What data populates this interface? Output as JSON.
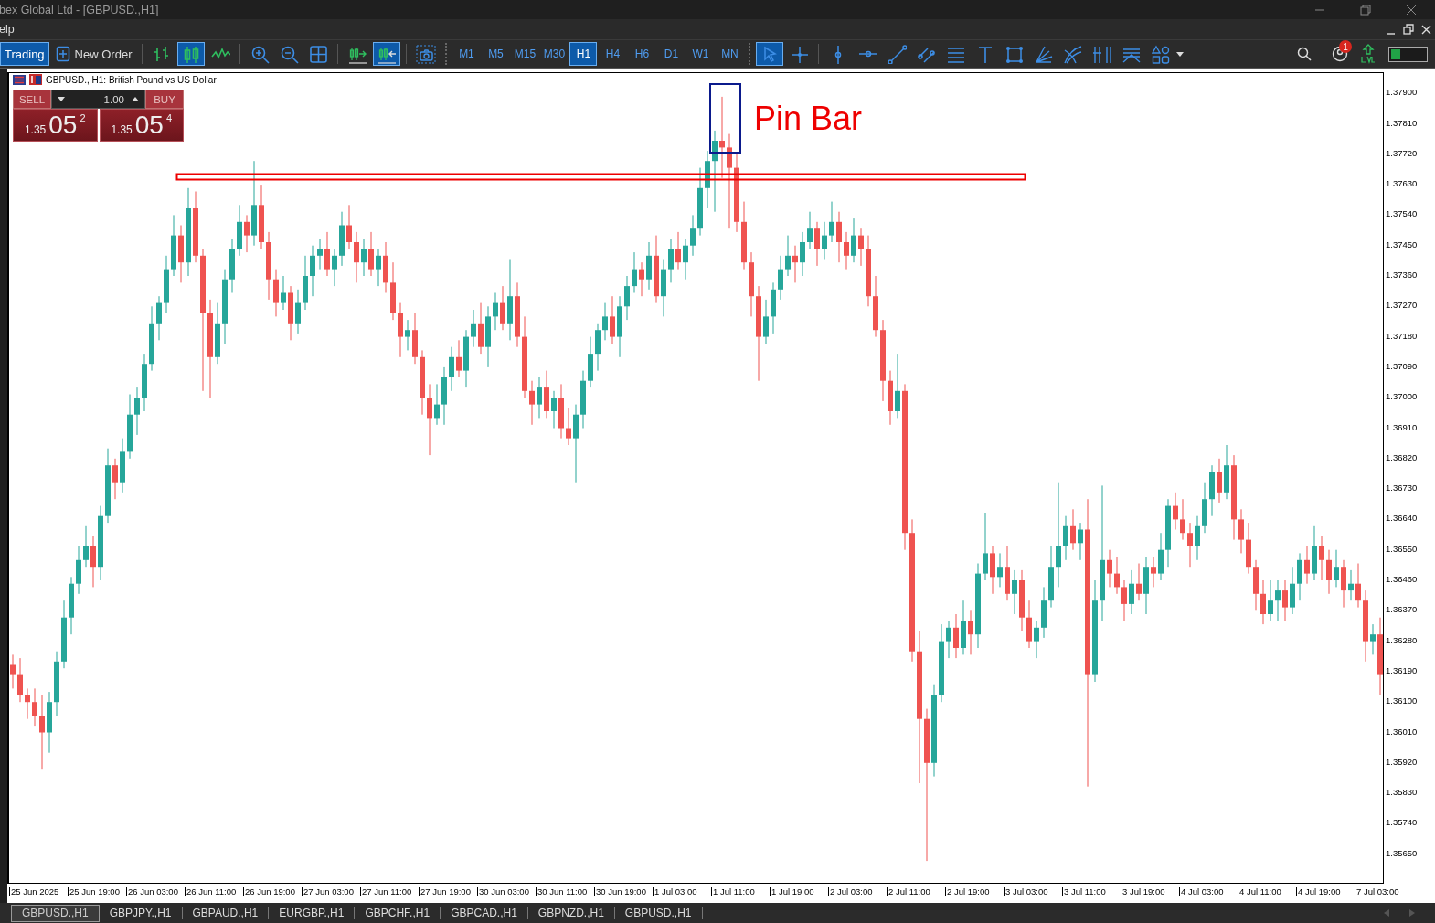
{
  "window": {
    "title": "bex Global Ltd - [GBPUSD.,H1]"
  },
  "menu": [
    "elp"
  ],
  "toolbar": {
    "trading": {
      "label": "Trading",
      "selected": true
    },
    "new_order": "New Order",
    "chart_types": [
      {
        "kind": "bars",
        "selected": false
      },
      {
        "kind": "candles",
        "selected": true
      },
      {
        "kind": "line",
        "selected": false
      }
    ],
    "chart_controls": [
      {
        "kind": "zoom-in"
      },
      {
        "kind": "zoom-out"
      },
      {
        "kind": "grid"
      }
    ],
    "scroll_controls": [
      {
        "kind": "shift",
        "selected": false
      },
      {
        "kind": "autoscroll",
        "selected": true
      }
    ],
    "timeframes": [
      {
        "label": "M1",
        "selected": false
      },
      {
        "label": "M5",
        "selected": false
      },
      {
        "label": "M15",
        "selected": false
      },
      {
        "label": "M30",
        "selected": false
      },
      {
        "label": "H1",
        "selected": true
      },
      {
        "label": "H4",
        "selected": false
      },
      {
        "label": "H6",
        "selected": false
      },
      {
        "label": "D1",
        "selected": false
      },
      {
        "label": "W1",
        "selected": false
      },
      {
        "label": "MN",
        "selected": false
      }
    ],
    "tools": [
      {
        "kind": "cursor",
        "selected": true
      },
      {
        "kind": "crosshair",
        "selected": false
      },
      {
        "kind": "vline",
        "selected": false
      },
      {
        "kind": "hline",
        "selected": false
      },
      {
        "kind": "trendline",
        "selected": false
      },
      {
        "kind": "channel",
        "selected": false
      },
      {
        "kind": "fibo",
        "selected": false
      },
      {
        "kind": "text",
        "selected": false
      },
      {
        "kind": "rectangle",
        "selected": false
      },
      {
        "kind": "fan",
        "selected": false
      },
      {
        "kind": "arcs",
        "selected": false
      },
      {
        "kind": "timezones",
        "selected": false
      },
      {
        "kind": "pitchfork",
        "selected": false
      },
      {
        "kind": "shapes",
        "selected": false
      }
    ],
    "notification_badge": "1"
  },
  "chart": {
    "title": "GBPUSD., H1:  British Pound vs US Dollar",
    "trade_panel": {
      "sell_label": "SELL",
      "buy_label": "BUY",
      "volume": "1.00",
      "sell_price": {
        "prefix": "1.35",
        "big": "05",
        "point": "2"
      },
      "buy_price": {
        "prefix": "1.35",
        "big": "05",
        "point": "4"
      }
    },
    "annotation": "Pin Bar",
    "time_axis": [
      "25 Jun 2025",
      "25 Jun 19:00",
      "26 Jun 03:00",
      "26 Jun 11:00",
      "26 Jun 19:00",
      "27 Jun 03:00",
      "27 Jun 11:00",
      "27 Jun 19:00",
      "30 Jun 03:00",
      "30 Jun 11:00",
      "30 Jun 19:00",
      "1 Jul 03:00",
      "1 Jul 11:00",
      "1 Jul 19:00",
      "2 Jul 03:00",
      "2 Jul 11:00",
      "2 Jul 19:00",
      "3 Jul 03:00",
      "3 Jul 11:00",
      "3 Jul 19:00",
      "4 Jul 03:00",
      "4 Jul 11:00",
      "4 Jul 19:00",
      "7 Jul 03:00"
    ],
    "chart_data": {
      "type": "candlestick",
      "ylim": [
        1.3556,
        1.3796
      ],
      "yticks": [
        {
          "value": 1.379,
          "label": "1.37900"
        },
        {
          "value": 1.3781,
          "label": "1.37810"
        },
        {
          "value": 1.3772,
          "label": "1.37720"
        },
        {
          "value": 1.3763,
          "label": "1.37630"
        },
        {
          "value": 1.3754,
          "label": "1.37540"
        },
        {
          "value": 1.3745,
          "label": "1.37450"
        },
        {
          "value": 1.3736,
          "label": "1.37360"
        },
        {
          "value": 1.3727,
          "label": "1.37270"
        },
        {
          "value": 1.3718,
          "label": "1.37180"
        },
        {
          "value": 1.3709,
          "label": "1.37090"
        },
        {
          "value": 1.37,
          "label": "1.37000"
        },
        {
          "value": 1.3691,
          "label": "1.36910"
        },
        {
          "value": 1.3682,
          "label": "1.36820"
        },
        {
          "value": 1.3673,
          "label": "1.36730"
        },
        {
          "value": 1.3664,
          "label": "1.36640"
        },
        {
          "value": 1.3655,
          "label": "1.36550"
        },
        {
          "value": 1.3646,
          "label": "1.36460"
        },
        {
          "value": 1.3637,
          "label": "1.36370"
        },
        {
          "value": 1.3628,
          "label": "1.36280"
        },
        {
          "value": 1.3619,
          "label": "1.36190"
        },
        {
          "value": 1.361,
          "label": "1.36100"
        },
        {
          "value": 1.3601,
          "label": "1.36010"
        },
        {
          "value": 1.3592,
          "label": "1.35920"
        },
        {
          "value": 1.3583,
          "label": "1.35830"
        },
        {
          "value": 1.3574,
          "label": "1.35740"
        },
        {
          "value": 1.3565,
          "label": "1.35650"
        }
      ],
      "ohlc": [
        [
          1.3621,
          1.3624,
          1.3614,
          1.3618
        ],
        [
          1.3618,
          1.3623,
          1.361,
          1.3612
        ],
        [
          1.3612,
          1.3614,
          1.3605,
          1.361
        ],
        [
          1.361,
          1.3614,
          1.3603,
          1.3606
        ],
        [
          1.3606,
          1.3612,
          1.359,
          1.3601
        ],
        [
          1.3601,
          1.3613,
          1.3595,
          1.361
        ],
        [
          1.361,
          1.3625,
          1.3606,
          1.3622
        ],
        [
          1.3622,
          1.364,
          1.362,
          1.3635
        ],
        [
          1.3635,
          1.3647,
          1.363,
          1.3645
        ],
        [
          1.3645,
          1.3656,
          1.3642,
          1.3652
        ],
        [
          1.3652,
          1.3662,
          1.365,
          1.3656
        ],
        [
          1.3656,
          1.3659,
          1.3644,
          1.365
        ],
        [
          1.365,
          1.3668,
          1.3646,
          1.3665
        ],
        [
          1.3665,
          1.3685,
          1.3663,
          1.368
        ],
        [
          1.368,
          1.3682,
          1.367,
          1.3675
        ],
        [
          1.3675,
          1.3688,
          1.3672,
          1.3684
        ],
        [
          1.3684,
          1.3701,
          1.3682,
          1.3695
        ],
        [
          1.3695,
          1.3703,
          1.3689,
          1.37
        ],
        [
          1.37,
          1.3713,
          1.3696,
          1.371
        ],
        [
          1.371,
          1.3727,
          1.3708,
          1.3722
        ],
        [
          1.3722,
          1.373,
          1.3717,
          1.3728
        ],
        [
          1.3728,
          1.3742,
          1.3725,
          1.3738
        ],
        [
          1.3738,
          1.3754,
          1.3736,
          1.3748
        ],
        [
          1.3748,
          1.3751,
          1.3734,
          1.374
        ],
        [
          1.374,
          1.3762,
          1.3736,
          1.3756
        ],
        [
          1.3756,
          1.3761,
          1.374,
          1.3742
        ],
        [
          1.3742,
          1.3744,
          1.3702,
          1.3725
        ],
        [
          1.3725,
          1.3729,
          1.37,
          1.3712
        ],
        [
          1.3712,
          1.3728,
          1.371,
          1.3722
        ],
        [
          1.3722,
          1.3738,
          1.3716,
          1.3735
        ],
        [
          1.3735,
          1.3747,
          1.3731,
          1.3744
        ],
        [
          1.3744,
          1.3757,
          1.3742,
          1.3752
        ],
        [
          1.3752,
          1.3754,
          1.3743,
          1.3748
        ],
        [
          1.3748,
          1.377,
          1.3745,
          1.3757
        ],
        [
          1.3757,
          1.3763,
          1.3744,
          1.3746
        ],
        [
          1.3746,
          1.3749,
          1.3729,
          1.3735
        ],
        [
          1.3735,
          1.3738,
          1.3724,
          1.3728
        ],
        [
          1.3728,
          1.3736,
          1.3726,
          1.3731
        ],
        [
          1.3731,
          1.3733,
          1.3717,
          1.3722
        ],
        [
          1.3722,
          1.3732,
          1.3719,
          1.3728
        ],
        [
          1.3728,
          1.3742,
          1.3726,
          1.3736
        ],
        [
          1.3736,
          1.3745,
          1.373,
          1.3742
        ],
        [
          1.3742,
          1.3747,
          1.3738,
          1.3744
        ],
        [
          1.3744,
          1.3749,
          1.3736,
          1.3738
        ],
        [
          1.3738,
          1.3744,
          1.3733,
          1.3742
        ],
        [
          1.3742,
          1.3755,
          1.3739,
          1.3751
        ],
        [
          1.3751,
          1.3757,
          1.3744,
          1.3746
        ],
        [
          1.3746,
          1.3749,
          1.3734,
          1.374
        ],
        [
          1.374,
          1.3747,
          1.3736,
          1.3744
        ],
        [
          1.3744,
          1.3749,
          1.3736,
          1.3738
        ],
        [
          1.3738,
          1.3744,
          1.3733,
          1.3742
        ],
        [
          1.3742,
          1.3746,
          1.3731,
          1.3734
        ],
        [
          1.3734,
          1.374,
          1.3723,
          1.3725
        ],
        [
          1.3725,
          1.3728,
          1.3712,
          1.3718
        ],
        [
          1.3718,
          1.3723,
          1.3714,
          1.372
        ],
        [
          1.372,
          1.3725,
          1.371,
          1.3712
        ],
        [
          1.3712,
          1.3714,
          1.3695,
          1.37
        ],
        [
          1.37,
          1.3704,
          1.3683,
          1.3694
        ],
        [
          1.3694,
          1.3704,
          1.3692,
          1.3698
        ],
        [
          1.3698,
          1.3709,
          1.3692,
          1.3706
        ],
        [
          1.3706,
          1.3715,
          1.3702,
          1.3712
        ],
        [
          1.3712,
          1.3717,
          1.3706,
          1.3708
        ],
        [
          1.3708,
          1.372,
          1.3703,
          1.3718
        ],
        [
          1.3718,
          1.3726,
          1.3715,
          1.3722
        ],
        [
          1.3722,
          1.3728,
          1.3713,
          1.3715
        ],
        [
          1.3715,
          1.3727,
          1.3709,
          1.3724
        ],
        [
          1.3724,
          1.3731,
          1.372,
          1.3728
        ],
        [
          1.3728,
          1.3733,
          1.372,
          1.3722
        ],
        [
          1.3722,
          1.3741,
          1.3717,
          1.373
        ],
        [
          1.373,
          1.3734,
          1.3715,
          1.3718
        ],
        [
          1.3718,
          1.3724,
          1.37,
          1.3702
        ],
        [
          1.3702,
          1.3705,
          1.3692,
          1.3698
        ],
        [
          1.3698,
          1.3706,
          1.3694,
          1.3703
        ],
        [
          1.3703,
          1.3708,
          1.3694,
          1.3696
        ],
        [
          1.3696,
          1.3702,
          1.3691,
          1.37
        ],
        [
          1.37,
          1.3704,
          1.3688,
          1.3691
        ],
        [
          1.3691,
          1.3697,
          1.3686,
          1.3688
        ],
        [
          1.3688,
          1.3698,
          1.3675,
          1.3695
        ],
        [
          1.3695,
          1.3708,
          1.3691,
          1.3705
        ],
        [
          1.3705,
          1.3718,
          1.3703,
          1.3713
        ],
        [
          1.3713,
          1.3722,
          1.3708,
          1.372
        ],
        [
          1.372,
          1.3728,
          1.3717,
          1.3724
        ],
        [
          1.3724,
          1.373,
          1.3716,
          1.3718
        ],
        [
          1.3718,
          1.373,
          1.3712,
          1.3727
        ],
        [
          1.3727,
          1.3736,
          1.3723,
          1.3733
        ],
        [
          1.3733,
          1.3743,
          1.3731,
          1.3738
        ],
        [
          1.3738,
          1.374,
          1.373,
          1.3735
        ],
        [
          1.3735,
          1.3746,
          1.3732,
          1.3742
        ],
        [
          1.3742,
          1.3748,
          1.3728,
          1.373
        ],
        [
          1.373,
          1.3741,
          1.3724,
          1.3738
        ],
        [
          1.3738,
          1.3747,
          1.3734,
          1.3744
        ],
        [
          1.3744,
          1.3749,
          1.3738,
          1.374
        ],
        [
          1.374,
          1.3747,
          1.3735,
          1.3745
        ],
        [
          1.3745,
          1.3754,
          1.3742,
          1.375
        ],
        [
          1.375,
          1.3768,
          1.3748,
          1.3762
        ],
        [
          1.3762,
          1.3773,
          1.3756,
          1.377
        ],
        [
          1.377,
          1.3779,
          1.3755,
          1.3776
        ],
        [
          1.3776,
          1.3789,
          1.3765,
          1.3774
        ],
        [
          1.3774,
          1.3778,
          1.375,
          1.3768
        ],
        [
          1.3768,
          1.3772,
          1.3749,
          1.3752
        ],
        [
          1.3752,
          1.3758,
          1.3738,
          1.374
        ],
        [
          1.374,
          1.3743,
          1.3724,
          1.373
        ],
        [
          1.373,
          1.3733,
          1.3705,
          1.3718
        ],
        [
          1.3718,
          1.3729,
          1.3716,
          1.3724
        ],
        [
          1.3724,
          1.3734,
          1.3719,
          1.3732
        ],
        [
          1.3732,
          1.3742,
          1.3729,
          1.3738
        ],
        [
          1.3738,
          1.3748,
          1.3736,
          1.3742
        ],
        [
          1.3742,
          1.3745,
          1.3734,
          1.374
        ],
        [
          1.374,
          1.3749,
          1.3736,
          1.3746
        ],
        [
          1.3746,
          1.3755,
          1.3744,
          1.375
        ],
        [
          1.375,
          1.3752,
          1.3739,
          1.3744
        ],
        [
          1.3744,
          1.3752,
          1.3741,
          1.3748
        ],
        [
          1.3748,
          1.3758,
          1.3746,
          1.3752
        ],
        [
          1.3752,
          1.3755,
          1.374,
          1.3746
        ],
        [
          1.3746,
          1.3749,
          1.3738,
          1.3742
        ],
        [
          1.3742,
          1.3753,
          1.374,
          1.3748
        ],
        [
          1.3748,
          1.375,
          1.3739,
          1.3744
        ],
        [
          1.3744,
          1.3748,
          1.3727,
          1.373
        ],
        [
          1.373,
          1.3736,
          1.3718,
          1.372
        ],
        [
          1.372,
          1.3723,
          1.3699,
          1.3705
        ],
        [
          1.3705,
          1.3708,
          1.3692,
          1.3696
        ],
        [
          1.3696,
          1.3713,
          1.3694,
          1.3702
        ],
        [
          1.3702,
          1.3704,
          1.3655,
          1.366
        ],
        [
          1.366,
          1.3664,
          1.3622,
          1.3625
        ],
        [
          1.3625,
          1.3631,
          1.3586,
          1.3605
        ],
        [
          1.3605,
          1.3608,
          1.3563,
          1.3592
        ],
        [
          1.3592,
          1.3615,
          1.3588,
          1.3612
        ],
        [
          1.3612,
          1.3633,
          1.361,
          1.3628
        ],
        [
          1.3628,
          1.3634,
          1.3623,
          1.3632
        ],
        [
          1.3632,
          1.3636,
          1.3623,
          1.3626
        ],
        [
          1.3626,
          1.364,
          1.3624,
          1.3634
        ],
        [
          1.3634,
          1.3637,
          1.3624,
          1.363
        ],
        [
          1.363,
          1.3651,
          1.3626,
          1.3648
        ],
        [
          1.3648,
          1.3666,
          1.3646,
          1.3654
        ],
        [
          1.3654,
          1.3656,
          1.3642,
          1.3647
        ],
        [
          1.3647,
          1.3654,
          1.3644,
          1.365
        ],
        [
          1.365,
          1.3656,
          1.364,
          1.3642
        ],
        [
          1.3642,
          1.3649,
          1.3636,
          1.3646
        ],
        [
          1.3646,
          1.3649,
          1.3631,
          1.3635
        ],
        [
          1.3635,
          1.364,
          1.3626,
          1.3628
        ],
        [
          1.3628,
          1.3634,
          1.3623,
          1.3632
        ],
        [
          1.3632,
          1.3644,
          1.3629,
          1.364
        ],
        [
          1.364,
          1.3656,
          1.3638,
          1.365
        ],
        [
          1.365,
          1.3675,
          1.3644,
          1.3656
        ],
        [
          1.3656,
          1.3665,
          1.3652,
          1.3662
        ],
        [
          1.3662,
          1.3667,
          1.3655,
          1.3657
        ],
        [
          1.3657,
          1.3663,
          1.3652,
          1.3661
        ],
        [
          1.3661,
          1.367,
          1.3585,
          1.3618
        ],
        [
          1.3618,
          1.3646,
          1.3616,
          1.364
        ],
        [
          1.364,
          1.3674,
          1.3634,
          1.3652
        ],
        [
          1.3652,
          1.3655,
          1.3644,
          1.3648
        ],
        [
          1.3648,
          1.3653,
          1.3642,
          1.3644
        ],
        [
          1.3644,
          1.3646,
          1.3634,
          1.3639
        ],
        [
          1.3639,
          1.3649,
          1.3636,
          1.3645
        ],
        [
          1.3645,
          1.3651,
          1.364,
          1.3642
        ],
        [
          1.3642,
          1.3653,
          1.3636,
          1.365
        ],
        [
          1.365,
          1.3653,
          1.3644,
          1.3648
        ],
        [
          1.3648,
          1.366,
          1.3646,
          1.3655
        ],
        [
          1.3655,
          1.367,
          1.365,
          1.3668
        ],
        [
          1.3668,
          1.3672,
          1.3661,
          1.3664
        ],
        [
          1.3664,
          1.367,
          1.3658,
          1.366
        ],
        [
          1.366,
          1.3663,
          1.365,
          1.3656
        ],
        [
          1.3656,
          1.3665,
          1.3652,
          1.3662
        ],
        [
          1.3662,
          1.3675,
          1.366,
          1.367
        ],
        [
          1.367,
          1.368,
          1.3665,
          1.3678
        ],
        [
          1.3678,
          1.3682,
          1.3669,
          1.3672
        ],
        [
          1.3672,
          1.3686,
          1.367,
          1.368
        ],
        [
          1.368,
          1.3683,
          1.3658,
          1.3664
        ],
        [
          1.3664,
          1.3667,
          1.3654,
          1.3658
        ],
        [
          1.3658,
          1.3663,
          1.3648,
          1.365
        ],
        [
          1.365,
          1.3652,
          1.3637,
          1.3642
        ],
        [
          1.3642,
          1.3646,
          1.3633,
          1.3636
        ],
        [
          1.3636,
          1.3646,
          1.3634,
          1.364
        ],
        [
          1.364,
          1.3646,
          1.3634,
          1.3643
        ],
        [
          1.3643,
          1.3646,
          1.3634,
          1.3638
        ],
        [
          1.3638,
          1.365,
          1.3636,
          1.3645
        ],
        [
          1.3645,
          1.3654,
          1.364,
          1.3652
        ],
        [
          1.3652,
          1.3656,
          1.3645,
          1.3648
        ],
        [
          1.3648,
          1.3662,
          1.3646,
          1.3656
        ],
        [
          1.3656,
          1.3659,
          1.3646,
          1.3652
        ],
        [
          1.3652,
          1.3655,
          1.3642,
          1.3646
        ],
        [
          1.3646,
          1.3655,
          1.3644,
          1.365
        ],
        [
          1.365,
          1.3652,
          1.3638,
          1.3643
        ],
        [
          1.3643,
          1.3649,
          1.364,
          1.3645
        ],
        [
          1.3645,
          1.3651,
          1.3638,
          1.364
        ],
        [
          1.364,
          1.3643,
          1.3622,
          1.3628
        ],
        [
          1.3628,
          1.3633,
          1.3624,
          1.363
        ],
        [
          1.363,
          1.3635,
          1.3612,
          1.3618
        ]
      ]
    }
  },
  "tabs": [
    {
      "label": "GBPUSD.,H1",
      "selected": true
    },
    {
      "label": "GBPJPY.,H1",
      "selected": false
    },
    {
      "label": "GBPAUD.,H1",
      "selected": false
    },
    {
      "label": "EURGBP.,H1",
      "selected": false
    },
    {
      "label": "GBPCHF.,H1",
      "selected": false
    },
    {
      "label": "GBPCAD.,H1",
      "selected": false
    },
    {
      "label": "GBPNZD.,H1",
      "selected": false
    },
    {
      "label": "GBPUSD.,H1",
      "selected": false
    }
  ]
}
